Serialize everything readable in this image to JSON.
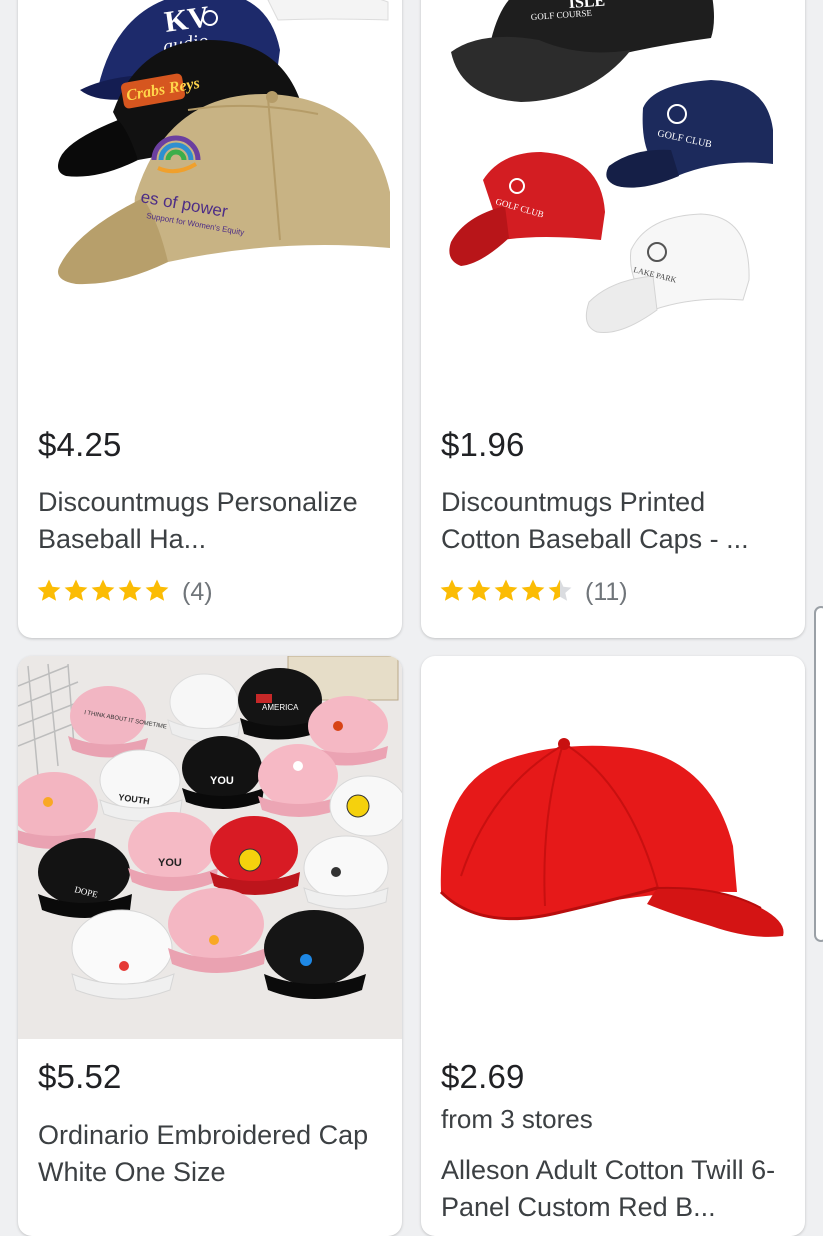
{
  "products": [
    {
      "price": "$4.25",
      "title": "Discountmugs Personalize Baseball Ha...",
      "rating": 5,
      "review_count": "(4)",
      "image_text": {
        "kv_top": "KV",
        "kv_bottom": "audio",
        "crab": "Crabs Reys",
        "power": "es of power",
        "power_sub": "Support for Women's Equity"
      }
    },
    {
      "price": "$1.96",
      "title": "Discountmugs Printed Cotton Baseball Caps - ...",
      "rating": 4.5,
      "review_count": "(11)",
      "image_text": {
        "black_cap_1": "ISLE",
        "black_cap_2": "GOLF COURSE",
        "golf_club": "GOLF CLUB",
        "golf_club_red": "GOLF CLUB",
        "lake_park": "LAKE PARK"
      }
    },
    {
      "price": "$5.52",
      "title": "Ordinario Embroidered Cap White One Size",
      "image_text": {
        "pink_note": "I THINK ABOUT IT SOMETIME",
        "america": "AMERICA",
        "you_black": "YOU",
        "youth": "YOUTH",
        "you_pink": "YOU",
        "dope": "DOPE"
      }
    },
    {
      "price": "$2.69",
      "stores": "from 3 stores",
      "title": "Alleson Adult Cotton Twill 6-Panel Custom Red B..."
    }
  ],
  "colors": {
    "star": "#fbbc04",
    "star_empty": "#dadce0",
    "price_text": "#202124",
    "title_text": "#3c4043",
    "muted_text": "#70757a",
    "background": "#eff0f2"
  }
}
